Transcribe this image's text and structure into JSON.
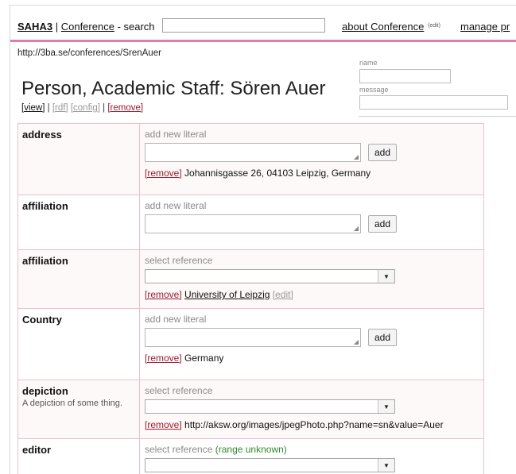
{
  "topbar": {
    "brand": "SAHA3",
    "sep": "|",
    "category_link": "Conference",
    "search_label": "- search",
    "search_value": "",
    "about_link": "about Conference",
    "about_edit": "(edit)",
    "manage_link": "manage pr"
  },
  "url": "http://3ba.se/conferences/SrenAuer",
  "page_title": "Person, Academic Staff: Sören Auer",
  "actions": {
    "view": "[view]",
    "sep1": "|",
    "rdf": "[rdf]",
    "config": "[config]",
    "sep2": "|",
    "remove": "[remove]"
  },
  "comment": {
    "name_label": "name",
    "name_value": "",
    "message_label": "message",
    "message_value": ""
  },
  "properties": [
    {
      "name": "address",
      "kind": "literal",
      "hint": "add new literal",
      "add_label": "add",
      "values": [
        {
          "remove": "[remove]",
          "text": "Johannisgasse 26, 04103 Leipzig, Germany"
        }
      ]
    },
    {
      "name": "affiliation",
      "kind": "literal",
      "hint": "add new literal",
      "add_label": "add",
      "values": []
    },
    {
      "name": "affiliation",
      "kind": "reference",
      "hint": "select reference",
      "values": [
        {
          "remove": "[remove]",
          "text": "University of Leipzig",
          "edit": "[edit]"
        }
      ]
    },
    {
      "name": "Country",
      "kind": "literal",
      "hint": "add new literal",
      "add_label": "add",
      "values": [
        {
          "remove": "[remove]",
          "text": "Germany"
        }
      ]
    },
    {
      "name": "depiction",
      "description": "A depiction of some thing.",
      "kind": "reference",
      "hint": "select reference",
      "values": [
        {
          "remove": "[remove]",
          "text": "http://aksw.org/images/jpegPhoto.php?name=sn&value=Auer"
        }
      ]
    },
    {
      "name": "editor",
      "kind": "reference",
      "hint": "select reference",
      "hint_extra": "(range unknown)",
      "values": []
    }
  ]
}
